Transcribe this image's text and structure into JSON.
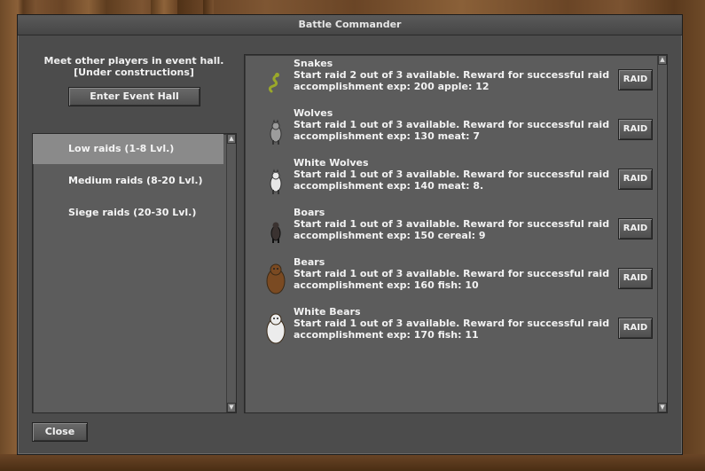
{
  "window": {
    "title": "Battle Commander"
  },
  "event_hall": {
    "info_line1": "Meet other players in event hall.",
    "info_line2": "[Under constructions]",
    "button_label": "Enter Event Hall"
  },
  "categories": [
    {
      "label": "Low raids (1-8 Lvl.)",
      "selected": true
    },
    {
      "label": "Medium raids (8-20 Lvl.)",
      "selected": false
    },
    {
      "label": "Siege raids (20-30 Lvl.)",
      "selected": false
    }
  ],
  "raids": [
    {
      "name": "Snakes",
      "line1": "Start raid 2 out of 3 available. Reward for successful raid",
      "line2": "accomplishment exp: 200 apple: 12",
      "button": "RAID",
      "icon": "snake-icon",
      "color": "#9aa82a"
    },
    {
      "name": "Wolves",
      "line1": "Start raid 1 out of 3 available. Reward for successful raid",
      "line2": "accomplishment exp: 130 meat: 7",
      "button": "RAID",
      "icon": "wolf-icon",
      "color": "#9c9c9c"
    },
    {
      "name": "White Wolves",
      "line1": "Start raid 1 out of 3 available. Reward for successful raid",
      "line2": "accomplishment exp: 140 meat: 8.",
      "button": "RAID",
      "icon": "white-wolf-icon",
      "color": "#e8e8e8"
    },
    {
      "name": "Boars",
      "line1": "Start raid 1 out of 3 available. Reward for successful raid",
      "line2": "accomplishment exp: 150 cereal: 9",
      "button": "RAID",
      "icon": "boar-icon",
      "color": "#3a3230"
    },
    {
      "name": "Bears",
      "line1": "Start raid 1 out of 3 available. Reward for successful raid",
      "line2": "accomplishment exp: 160 fish: 10",
      "button": "RAID",
      "icon": "bear-icon",
      "color": "#7a4a22"
    },
    {
      "name": "White Bears",
      "line1": "Start raid 1 out of 3 available. Reward for successful raid",
      "line2": "accomplishment exp: 170 fish: 11",
      "button": "RAID",
      "icon": "white-bear-icon",
      "color": "#ececec"
    }
  ],
  "footer": {
    "close_label": "Close"
  }
}
